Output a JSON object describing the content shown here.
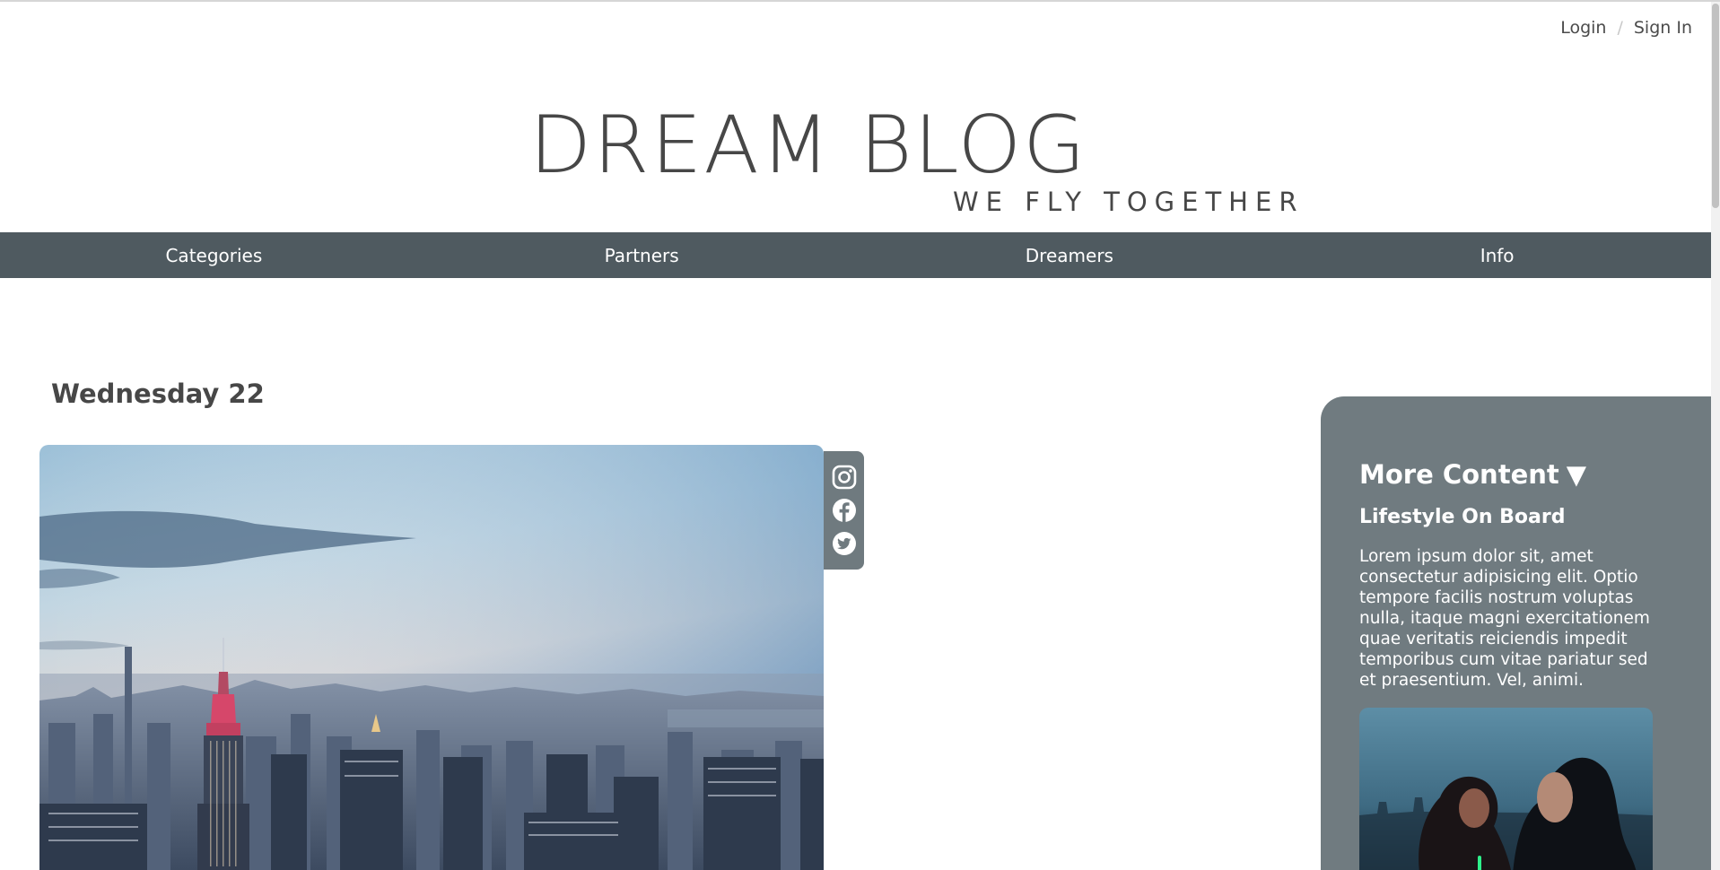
{
  "auth": {
    "login_label": "Login",
    "separator": "/",
    "signin_label": "Sign In"
  },
  "logo": {
    "title": "DREAM BLOG",
    "tagline": "WE FLY TOGETHER"
  },
  "nav": {
    "items": [
      {
        "label": "Categories"
      },
      {
        "label": "Partners"
      },
      {
        "label": "Dreamers"
      },
      {
        "label": "Info"
      }
    ],
    "background": "#4f5a60"
  },
  "main": {
    "date_heading": "Wednesday 22",
    "hero_image": "new-york-skyline-empire-state-building-photo"
  },
  "social": {
    "icons": [
      "instagram-icon",
      "facebook-icon",
      "twitter-icon"
    ],
    "background": "#6f7a7f"
  },
  "sidebar": {
    "title": "More Content",
    "toggle_glyph": "▼",
    "article_title": "Lifestyle On Board",
    "article_text": "Lorem ipsum dolor sit, amet consectetur adipisicing elit. Optio tempore facilis nostrum voluptas nulla, itaque magni exercitationem quae veritatis reiciendis impedit temporibus cum vitae pariatur sed et praesentium. Vel, animi.",
    "article_image": "movie-poster-couple-photo",
    "background": "#707b80"
  }
}
